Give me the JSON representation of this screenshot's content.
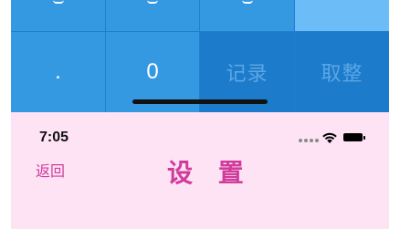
{
  "keypad": {
    "row_bottom": [
      {
        "label": "."
      },
      {
        "label": "0"
      },
      {
        "label": "记录"
      },
      {
        "label": "取整"
      }
    ]
  },
  "status_bar": {
    "time": "7:05",
    "icons": [
      "cellular-dots-icon",
      "wifi-icon",
      "battery-icon"
    ]
  },
  "nav": {
    "back_label": "返回",
    "title": "设 置"
  },
  "colors": {
    "keypad_blue": "#3599e2",
    "keypad_dark": "#1d7bcc",
    "keypad_light": "#6bbcf7",
    "panel_pink": "#fde3f4",
    "accent_magenta": "#d13b9c"
  }
}
